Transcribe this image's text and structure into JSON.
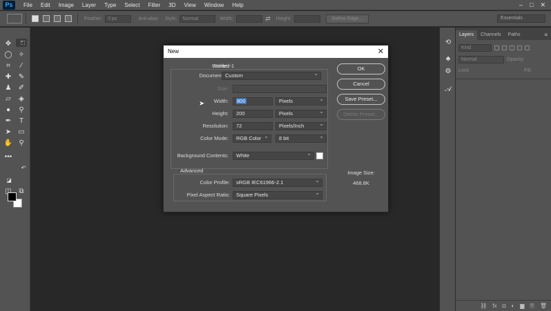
{
  "menubar": {
    "logo": "Ps",
    "items": [
      "File",
      "Edit",
      "Image",
      "Layer",
      "Type",
      "Select",
      "Filter",
      "3D",
      "View",
      "Window",
      "Help"
    ],
    "window_controls": [
      "–",
      "□",
      "✕"
    ]
  },
  "optionsbar": {
    "feather_label": "Feather:",
    "feather_value": "0 px",
    "antialias_label": "Anti-alias",
    "style_label": "Style:",
    "style_value": "Normal",
    "width_label": "Width:",
    "height_label": "Height:",
    "refine_button": "Refine Edge...",
    "workspace": "Essentials"
  },
  "panel": {
    "tabs": [
      "Layers",
      "Channels",
      "Paths"
    ],
    "kind": "Kind",
    "blend_mode": "Normal",
    "opacity_label": "Opacity:",
    "lock_label": "Lock:",
    "fill_label": "Fill:",
    "footer_icons": [
      "⛓",
      "fx",
      "◘",
      "◐",
      "▆",
      "⎘",
      "🗑"
    ]
  },
  "dialog": {
    "title": "New",
    "close": "✕",
    "name_label": "Name:",
    "name_value": "Untitled-1",
    "doc_type_label": "Document Type:",
    "doc_type_value": "Custom",
    "size_label": "Size:",
    "width_label": "Width:",
    "width_value": "800",
    "width_unit": "Pixels",
    "height_label": "Height:",
    "height_value": "200",
    "height_unit": "Pixels",
    "resolution_label": "Resolution:",
    "resolution_value": "72",
    "resolution_unit": "Pixels/Inch",
    "color_mode_label": "Color Mode:",
    "color_mode_value": "RGB Color",
    "bit_depth": "8 bit",
    "bg_contents_label": "Background Contents:",
    "bg_contents_value": "White",
    "advanced_label": "Advanced",
    "color_profile_label": "Color Profile:",
    "color_profile_value": "sRGB IEC61966-2.1",
    "pixel_aspect_label": "Pixel Aspect Ratio:",
    "pixel_aspect_value": "Square Pixels",
    "ok": "OK",
    "cancel": "Cancel",
    "save_preset": "Save Preset...",
    "delete_preset": "Delete Preset...",
    "image_size_label": "Image Size:",
    "image_size_value": "468.8K"
  }
}
